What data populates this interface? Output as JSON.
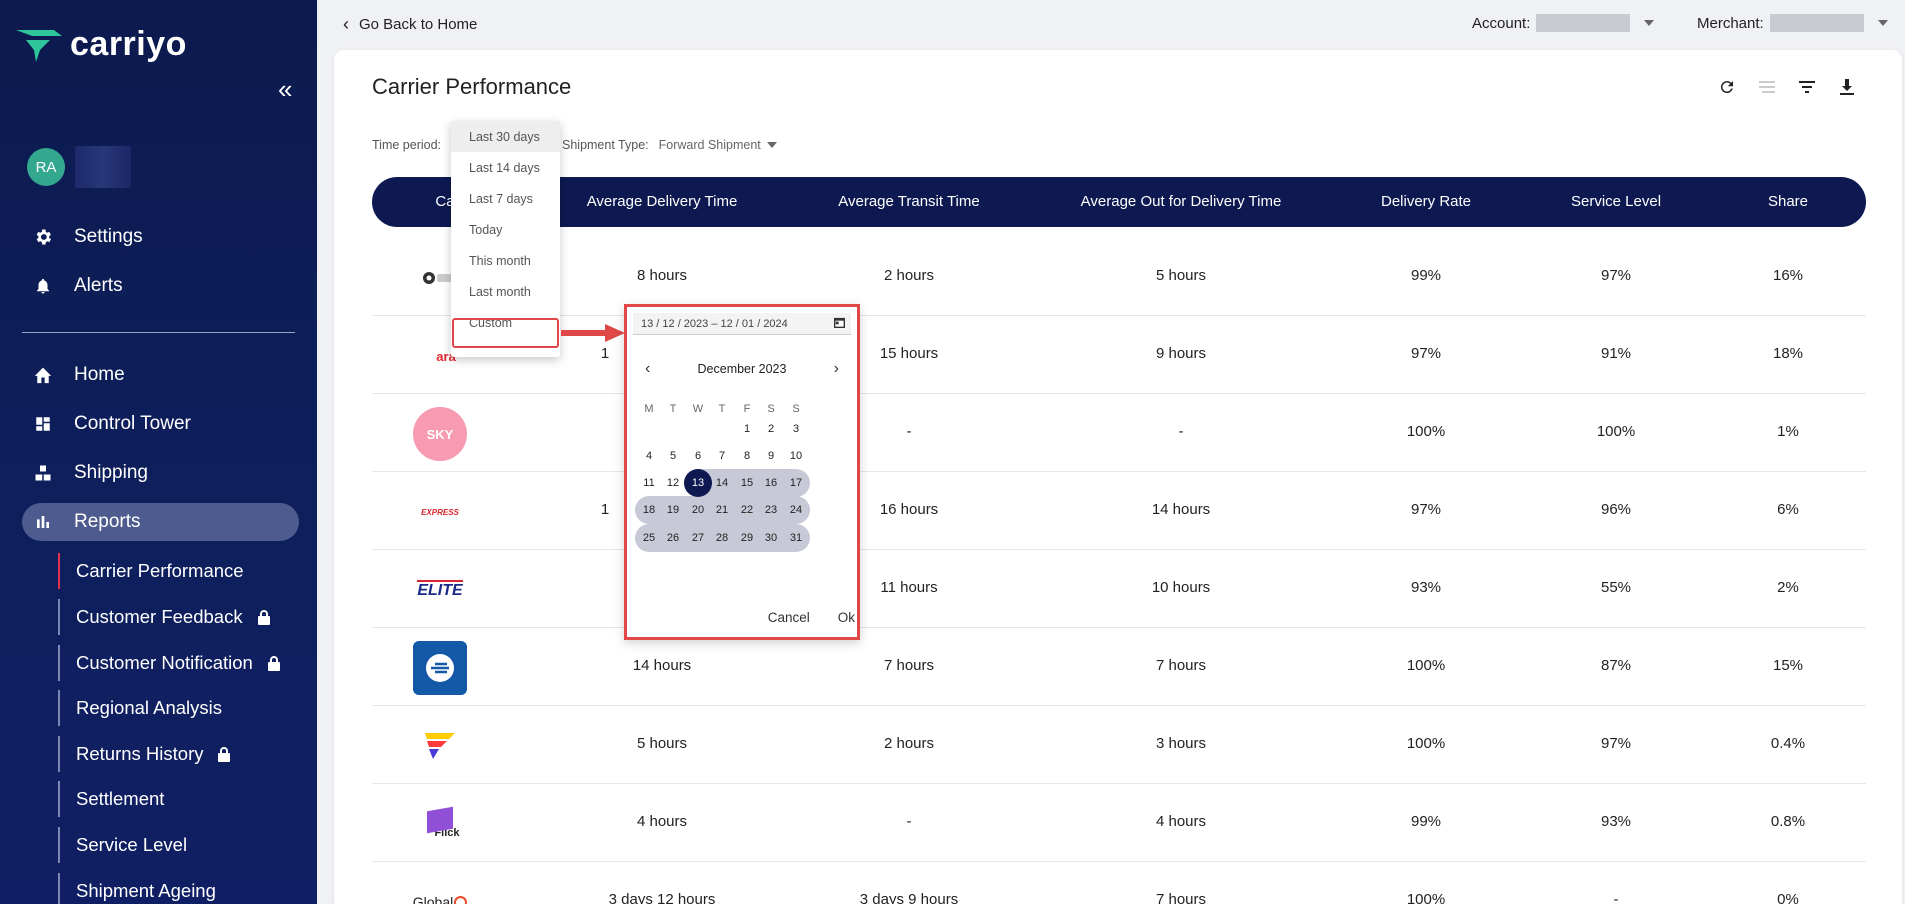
{
  "brand": {
    "name": "carriyo"
  },
  "user": {
    "initials": "RA"
  },
  "sidebar": {
    "top_items": [
      {
        "label": "Settings",
        "icon": "gear-icon"
      },
      {
        "label": "Alerts",
        "icon": "bell-icon"
      }
    ],
    "items": [
      {
        "label": "Home",
        "icon": "home-icon"
      },
      {
        "label": "Control Tower",
        "icon": "dashboard-icon"
      },
      {
        "label": "Shipping",
        "icon": "boxes-icon"
      },
      {
        "label": "Reports",
        "icon": "bar-chart-icon",
        "active": true
      }
    ],
    "report_items": [
      {
        "label": "Carrier Performance",
        "locked": false,
        "active": true
      },
      {
        "label": "Customer Feedback",
        "locked": true
      },
      {
        "label": "Customer Notification",
        "locked": true
      },
      {
        "label": "Regional Analysis",
        "locked": false
      },
      {
        "label": "Returns History",
        "locked": true
      },
      {
        "label": "Settlement",
        "locked": false
      },
      {
        "label": "Service Level",
        "locked": false
      },
      {
        "label": "Shipment Ageing",
        "locked": false
      }
    ]
  },
  "topbar": {
    "back_label": "Go Back to Home",
    "account_label": "Account:",
    "merchant_label": "Merchant:"
  },
  "page": {
    "title": "Carrier Performance",
    "time_period_label": "Time period:",
    "shipment_type_label": "Shipment Type:",
    "shipment_type_value": "Forward Shipment"
  },
  "table": {
    "headers": [
      "Carr",
      "Average Delivery Time",
      "Average Transit Time",
      "Average Out for Delivery Time",
      "Delivery Rate",
      "Service Level",
      "Share"
    ],
    "rows": [
      {
        "carrier": "pickup-logo",
        "delivery": "8 hours",
        "transit": "2 hours",
        "ofd": "5 hours",
        "rate": "99%",
        "service": "97%",
        "share": "16%"
      },
      {
        "carrier": "aramex-logo",
        "logo_text": "ara",
        "delivery": "1",
        "transit": "15 hours",
        "ofd": "9 hours",
        "rate": "97%",
        "service": "91%",
        "share": "18%"
      },
      {
        "carrier": "sky-logo",
        "logo_text": "SKY",
        "delivery": "",
        "transit": "-",
        "ofd": "-",
        "rate": "100%",
        "service": "100%",
        "share": "1%"
      },
      {
        "carrier": "express-logo",
        "logo_text": "EXPRESS",
        "delivery": "1",
        "transit": "16 hours",
        "ofd": "14 hours",
        "rate": "97%",
        "service": "96%",
        "share": "6%"
      },
      {
        "carrier": "elite-logo",
        "logo_text": "ELITE",
        "delivery": "",
        "transit": "11 hours",
        "ofd": "10 hours",
        "rate": "93%",
        "service": "55%",
        "share": "2%"
      },
      {
        "carrier": "blue-logo",
        "delivery": "14 hours",
        "transit": "7 hours",
        "ofd": "7 hours",
        "rate": "100%",
        "service": "87%",
        "share": "15%"
      },
      {
        "carrier": "flag-logo",
        "delivery": "5 hours",
        "transit": "2 hours",
        "ofd": "3 hours",
        "rate": "100%",
        "service": "97%",
        "share": "0.4%"
      },
      {
        "carrier": "flick-logo",
        "logo_text": "Flick",
        "delivery": "4 hours",
        "transit": "-",
        "ofd": "4 hours",
        "rate": "99%",
        "service": "93%",
        "share": "0.8%"
      },
      {
        "carrier": "global-logo",
        "logo_text": "Global",
        "delivery": "3 days 12 hours",
        "transit": "3 days 9 hours",
        "ofd": "7 hours",
        "rate": "100%",
        "service": "-",
        "share": "0%"
      }
    ]
  },
  "time_dropdown": {
    "options": [
      "Last 30 days",
      "Last 14 days",
      "Last 7 days",
      "Today",
      "This month",
      "Last month",
      "Custom"
    ],
    "selected": "Last 30 days",
    "highlighted": "Custom"
  },
  "date_picker": {
    "range_text": "13 / 12 / 2023  –  12 / 01 / 2024",
    "month_label": "December 2023",
    "weekdays": [
      "M",
      "T",
      "W",
      "T",
      "F",
      "S",
      "S"
    ],
    "first_weekday_index": 4,
    "days_in_month": 31,
    "range_start_day": 13,
    "cancel_label": "Cancel",
    "ok_label": "Ok"
  },
  "colors": {
    "sidebar_bg": "#0e1f5c",
    "header_bg": "#0d1950",
    "highlight_red": "#e04848",
    "avatar_bg": "#33a88f"
  }
}
